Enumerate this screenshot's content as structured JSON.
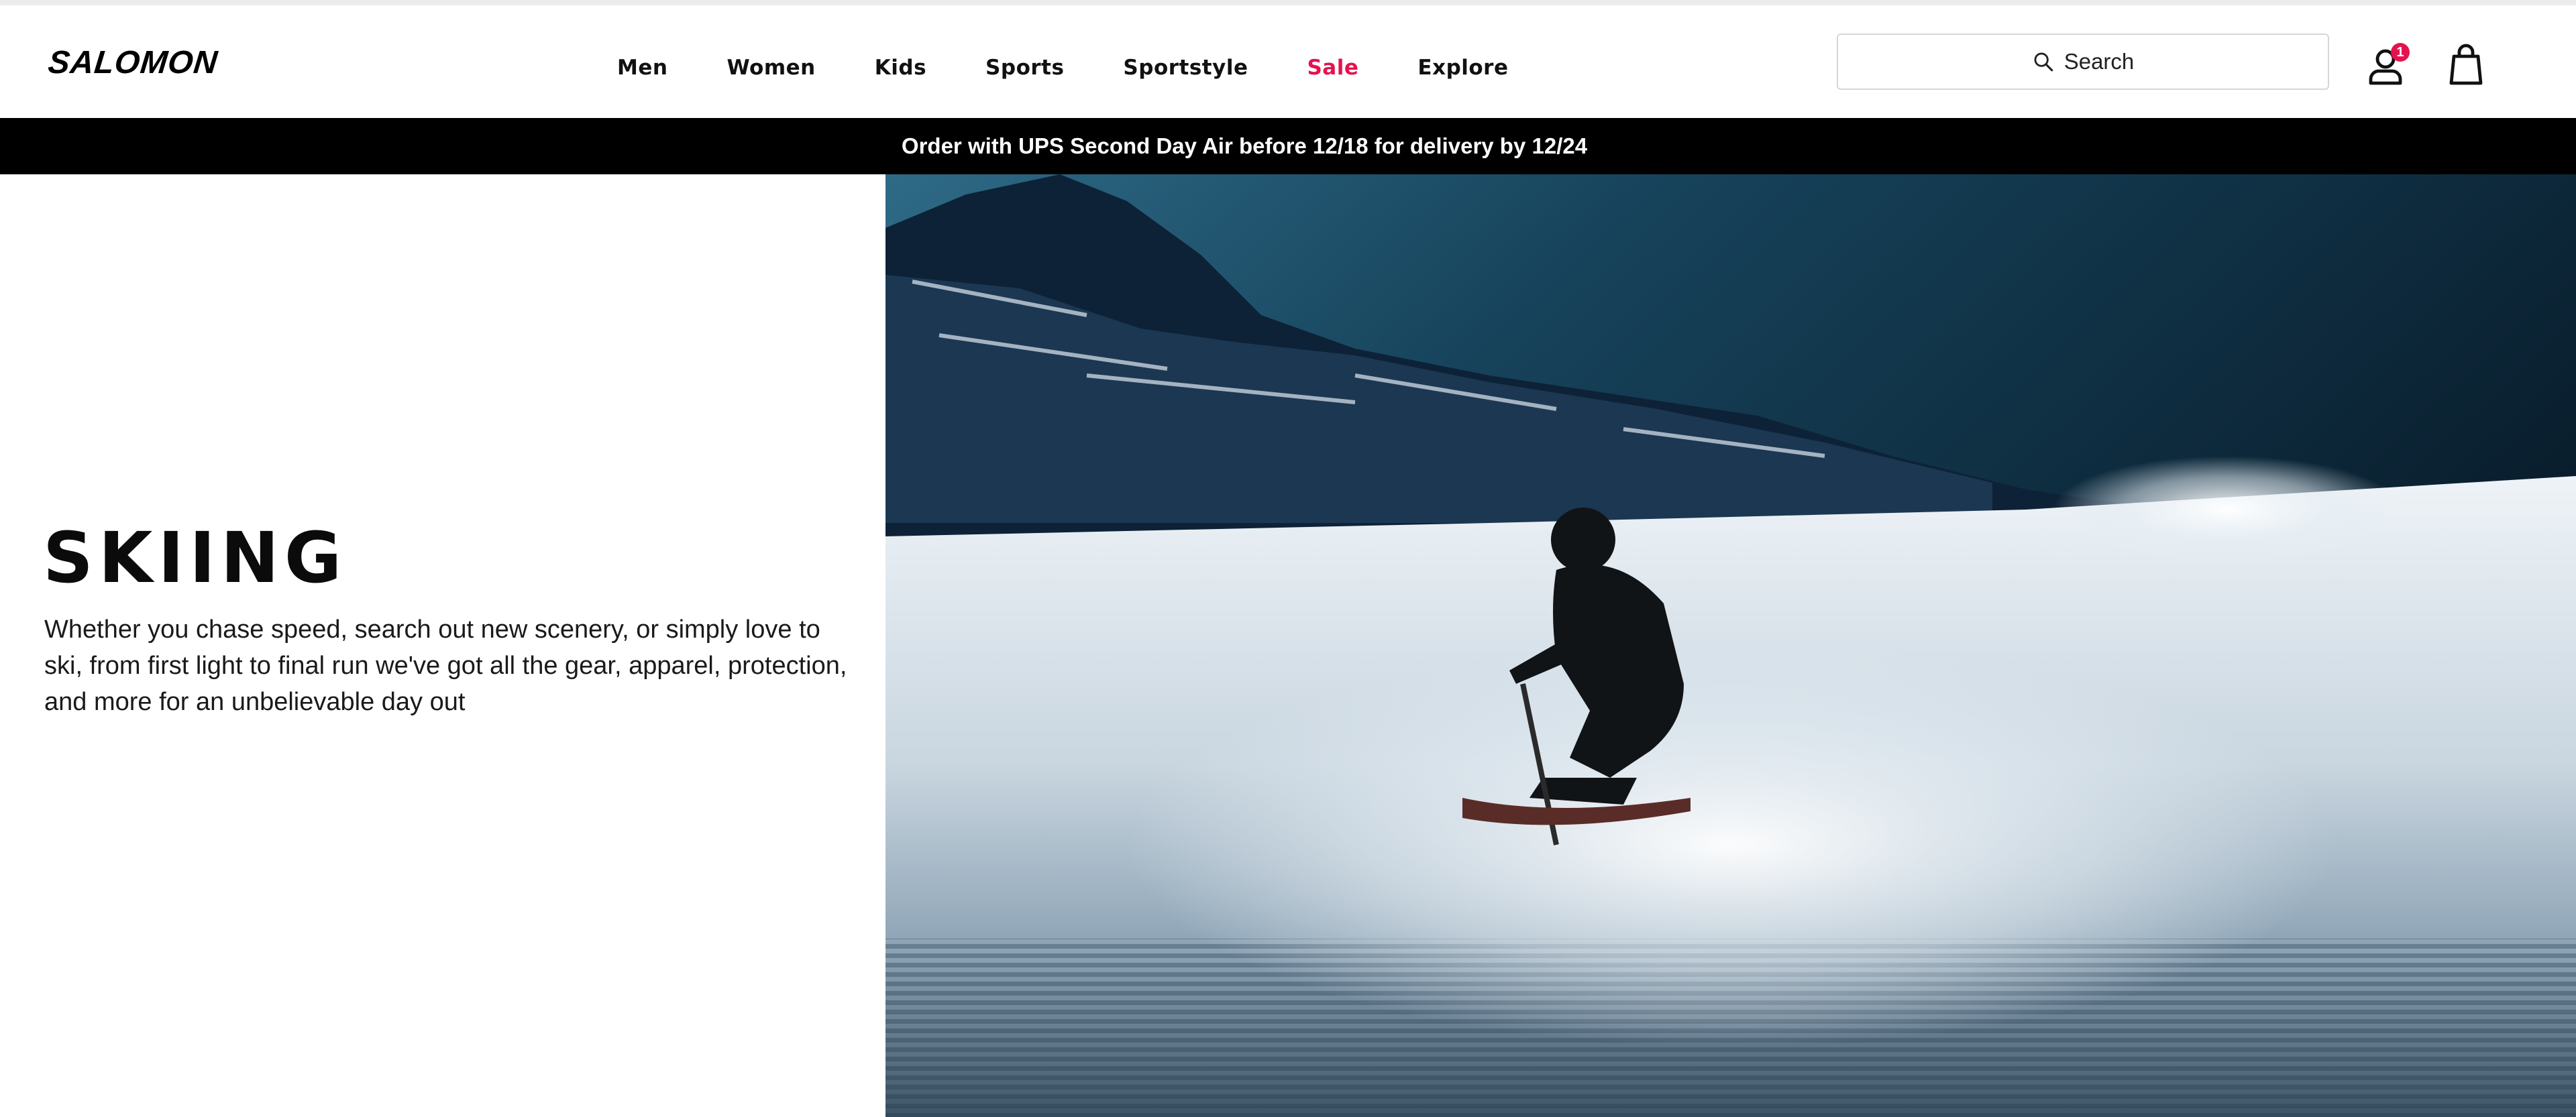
{
  "brand": {
    "logo_text": "SALOMON"
  },
  "nav": {
    "items": [
      {
        "label": "Men"
      },
      {
        "label": "Women"
      },
      {
        "label": "Kids"
      },
      {
        "label": "Sports"
      },
      {
        "label": "Sportstyle"
      },
      {
        "label": "Sale",
        "color": "#e4134f"
      },
      {
        "label": "Explore"
      }
    ]
  },
  "search": {
    "label": "Search",
    "icon": "search-icon"
  },
  "account": {
    "icon": "user-icon",
    "badge_count": "1",
    "badge_color": "#e4134f"
  },
  "cart": {
    "icon": "shopping-bag-icon"
  },
  "promo_banner": {
    "text": "Order with UPS Second Day Air before 12/18 for delivery by 12/24"
  },
  "hero": {
    "title": "SKIING",
    "description": "Whether you chase speed, search out new scenery, or simply love to ski, from first light to final run we've got all the gear, apparel, protection, and more for an unbelievable day out",
    "image": "skier-on-groomed-slope-photo"
  }
}
